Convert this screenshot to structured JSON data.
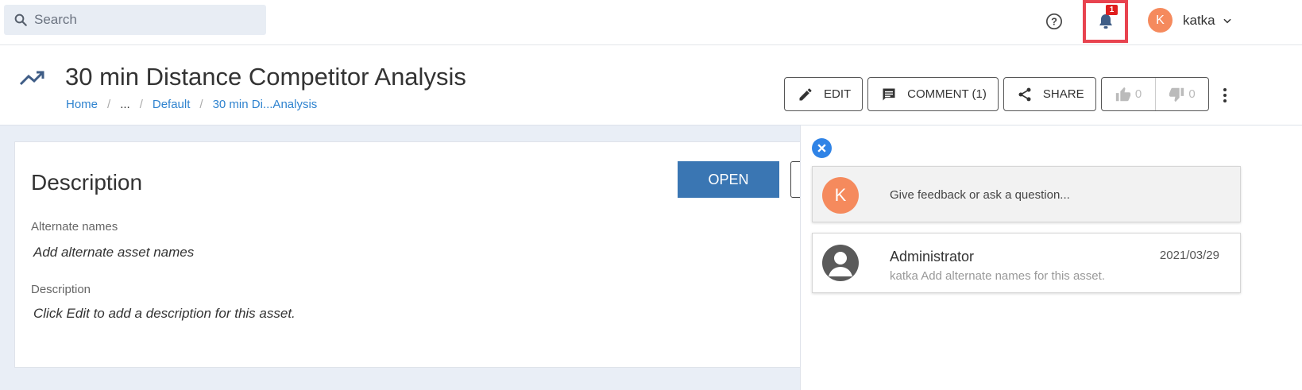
{
  "search": {
    "placeholder": "Search"
  },
  "topbar": {
    "notification_count": "1",
    "user_initial": "K",
    "user_name": "katka",
    "icons": [
      "search-icon",
      "help-icon",
      "bell-icon",
      "chevron-down-icon"
    ]
  },
  "header": {
    "title": "30 min Distance Competitor Analysis",
    "breadcrumb": [
      "Home",
      "...",
      "Default",
      "30 min Di...Analysis"
    ],
    "actions": {
      "edit": "EDIT",
      "comment": "COMMENT (1)",
      "share": "SHARE",
      "likes": "0",
      "dislikes": "0"
    }
  },
  "main": {
    "section_title": "Description",
    "open_label": "OPEN",
    "fields": [
      {
        "label": "Alternate names",
        "value": "Add alternate asset names"
      },
      {
        "label": "Description",
        "value": "Click Edit to add a description for this asset."
      }
    ]
  },
  "comments_panel": {
    "compose_initial": "K",
    "compose_placeholder": "Give feedback or ask a question...",
    "comments": [
      {
        "author": "Administrator",
        "date": "2021/03/29",
        "text": "katka Add alternate names for this asset."
      }
    ]
  },
  "colors": {
    "accent_blue": "#3a76b3",
    "link_blue": "#2f83cf",
    "avatar_orange": "#f58a5d",
    "highlight_red": "#e8434f",
    "badge_red": "#e01e1e"
  }
}
